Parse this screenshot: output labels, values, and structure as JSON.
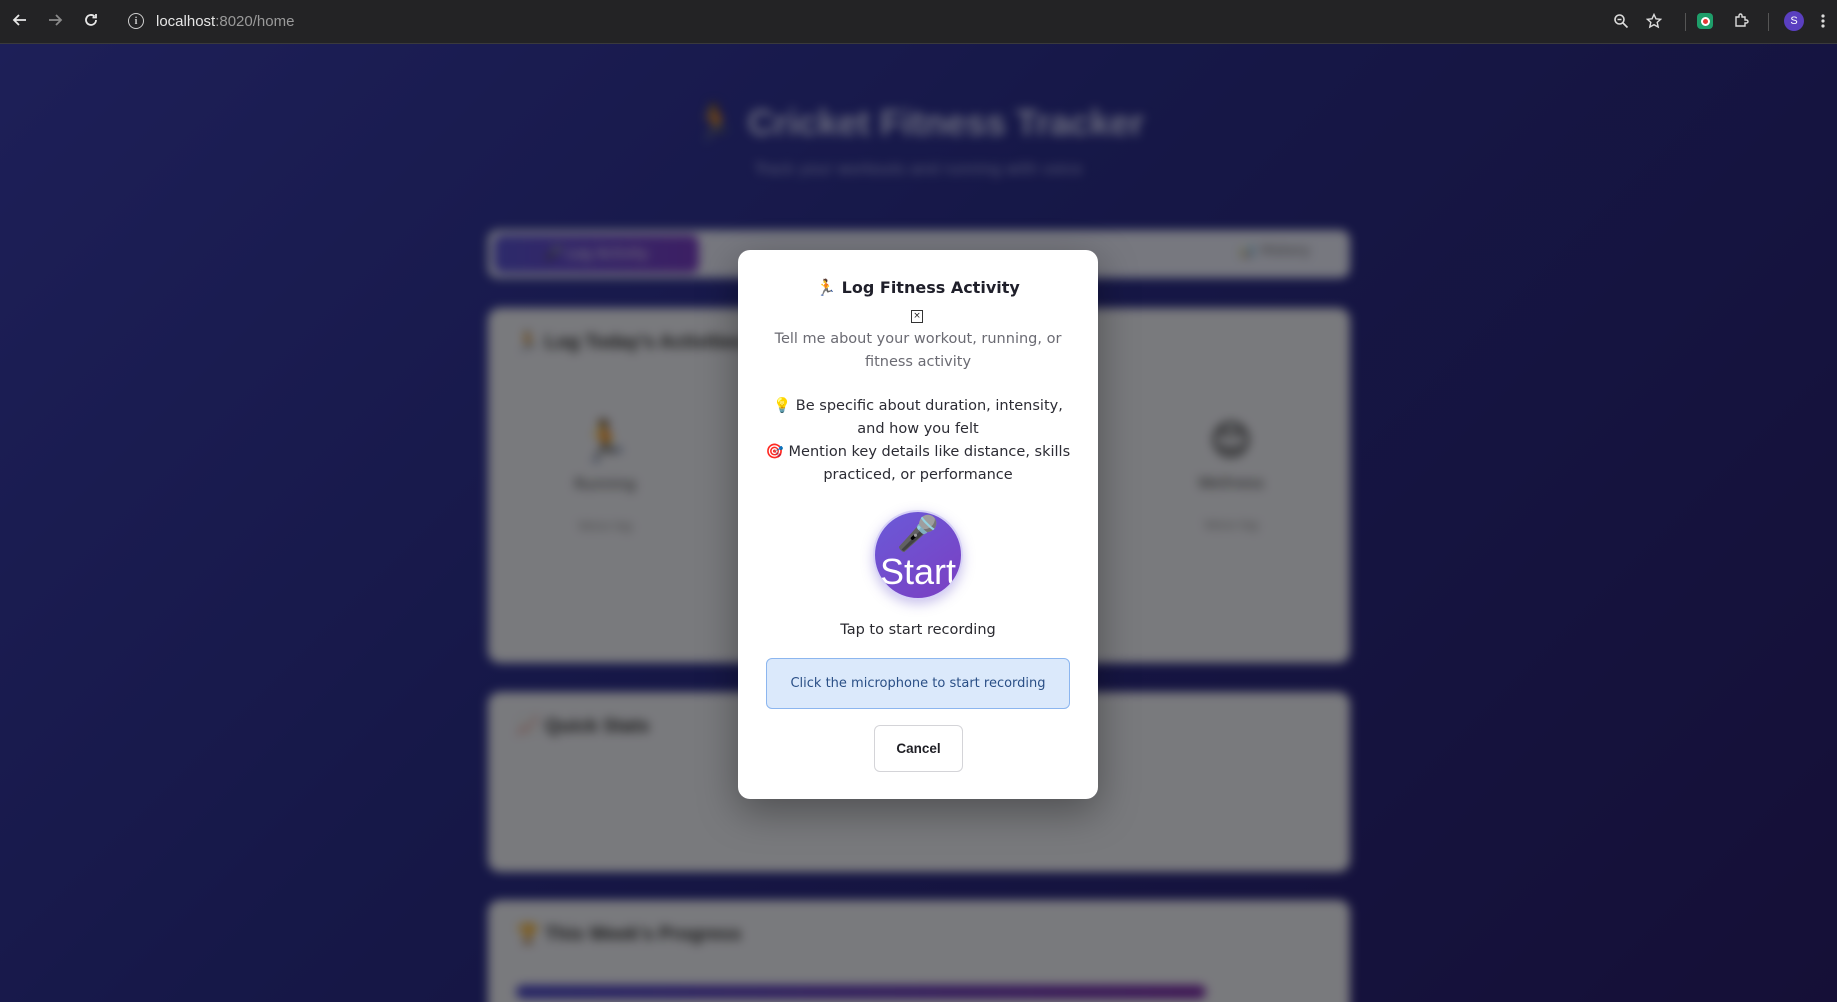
{
  "browser": {
    "url_host": "localhost",
    "url_rest": ":8020/home",
    "avatar_letter": "S"
  },
  "background_app": {
    "title": "🏃 Cricket Fitness Tracker",
    "subtitle": "Track your workouts and running with voice",
    "tab_active": "🎤 Log Activity",
    "tab_other": "📊 History",
    "card1_title": "🏃 Log Today's Activities",
    "options": [
      {
        "emoji": "🏃",
        "label": "Running",
        "sub": "Voice log"
      },
      {
        "emoji": "😊",
        "label": "Wellness",
        "sub": "Voice log"
      }
    ],
    "card2_title": "📈 Quick Stats",
    "card3_title": "🏆 This Week's Progress"
  },
  "modal": {
    "title": "🏃 Log Fitness Activity",
    "close_label": "×",
    "description": "Tell me about your workout, running, or fitness activity",
    "tips": [
      "💡 Be specific about duration, intensity, and how you felt",
      "🎯 Mention key details like distance, skills practiced, or performance"
    ],
    "mic_emoji": "🎤",
    "mic_label": "Start",
    "tap_hint": "Tap to start recording",
    "status_message": "Click the microphone to start recording",
    "cancel_label": "Cancel"
  },
  "colors": {
    "accent_gradient_start": "#6a5ad8",
    "accent_gradient_end": "#7b3fc2",
    "status_bg": "#dbe9fb",
    "status_border": "#8cb6ef"
  }
}
